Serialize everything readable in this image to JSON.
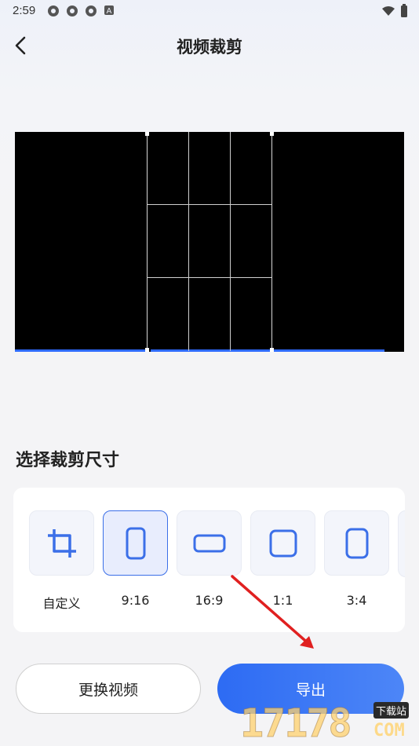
{
  "status_bar": {
    "time": "2:59",
    "left_icons": [
      "notification-icon",
      "notification-icon",
      "notification-icon",
      "text-a-icon"
    ],
    "right_icons": [
      "wifi-icon",
      "battery-icon"
    ]
  },
  "header": {
    "title": "视频裁剪",
    "back_icon": "chevron-left-icon"
  },
  "video_preview": {
    "background": "#000000",
    "accent_color": "#2f6bff"
  },
  "crop_section": {
    "title": "选择裁剪尺寸",
    "options": [
      {
        "label": "自定义",
        "icon": "crop-icon",
        "selected": false
      },
      {
        "label": "9:16",
        "icon": "portrait-rect-icon",
        "selected": true
      },
      {
        "label": "16:9",
        "icon": "landscape-rect-icon",
        "selected": false
      },
      {
        "label": "1:1",
        "icon": "square-icon",
        "selected": false
      },
      {
        "label": "3:4",
        "icon": "portrait-3-4-icon",
        "selected": false
      }
    ]
  },
  "actions": {
    "change_video_label": "更换视频",
    "export_label": "导出"
  },
  "watermark": {
    "logo": "17178",
    "badge": "下载站",
    "domain": "COM"
  },
  "colors": {
    "accent": "#3b6fe8",
    "annotation_arrow": "#e02020"
  }
}
